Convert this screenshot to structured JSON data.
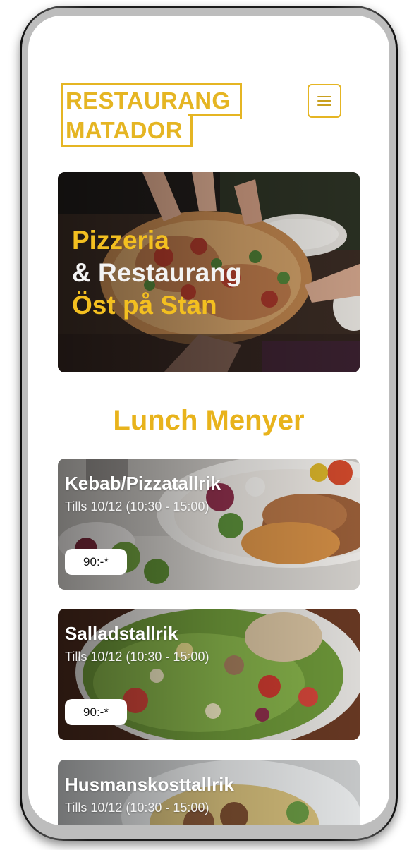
{
  "header": {
    "logo_line_1": "RESTAURANG",
    "logo_line_2": "MATADOR",
    "menu_icon": "hamburger-icon"
  },
  "hero": {
    "line_1": "Pizzeria",
    "line_2": "& Restaurang",
    "line_3": "Öst på Stan"
  },
  "lunch": {
    "section_title": "Lunch Menyer",
    "items": [
      {
        "title": "Kebab/Pizzatallrik",
        "subtitle": "Tills 10/12 (10:30 - 15:00)",
        "price": "90:-*"
      },
      {
        "title": "Salladstallrik",
        "subtitle": "Tills 10/12 (10:30 - 15:00)",
        "price": "90:-*"
      },
      {
        "title": "Husmanskosttallrik",
        "subtitle": "Tills 10/12 (10:30 - 15:00)"
      }
    ]
  },
  "colors": {
    "brand_yellow": "#e5b523",
    "hero_white": "#f3f3f3"
  }
}
